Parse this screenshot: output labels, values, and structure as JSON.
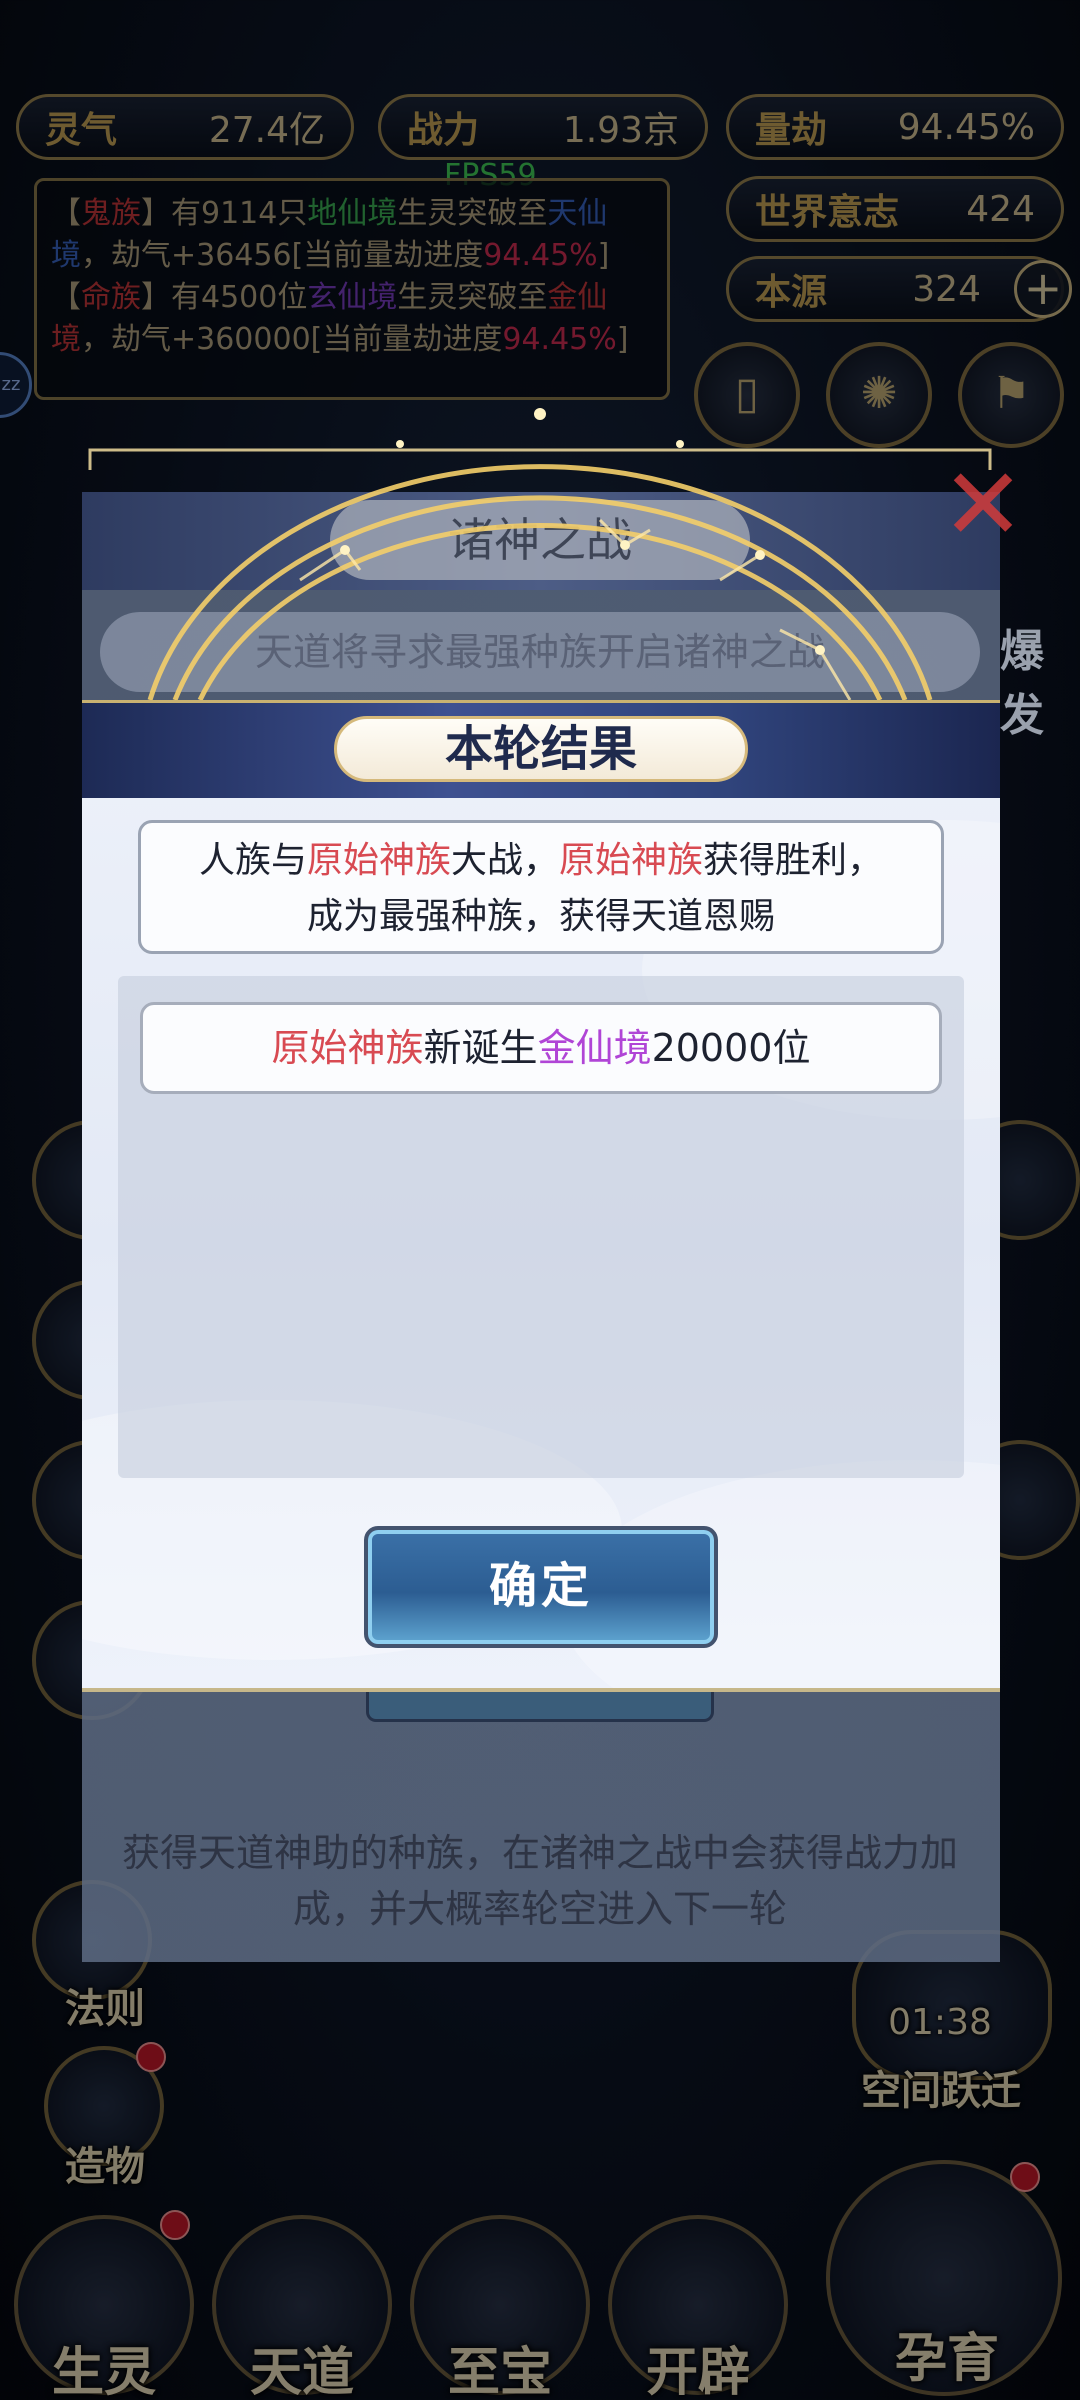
{
  "hud": {
    "qi": {
      "label": "灵气",
      "value": "27.4亿"
    },
    "power": {
      "label": "战力",
      "value": "1.93京"
    },
    "calamity": {
      "label": "量劫",
      "value": "94.45%"
    },
    "world_will": {
      "label": "世界意志",
      "value": "424"
    },
    "origin": {
      "label": "本源",
      "value": "324",
      "plus": "+"
    },
    "fps": "FPS59"
  },
  "log": {
    "line1": {
      "tag_open": "【",
      "race": "鬼族",
      "tag_close": "】",
      "t1": "有9114只",
      "realm": "地仙境",
      "t2": "生灵突破至",
      "target": "天仙境",
      "t3": "，劫气+36456[当前量劫进度",
      "progress": "94.45%",
      "t4": "]"
    },
    "line2": {
      "tag_open": "【",
      "race": "命族",
      "tag_close": "】",
      "t1": "有4500位",
      "realm": "玄仙境",
      "t2": "生灵突破至",
      "target": "金仙境",
      "t3": "，劫气+360000[当前量劫进度",
      "progress": "94.45%",
      "t4": "]"
    },
    "zz": "zz"
  },
  "side_menu": {
    "law": "法则",
    "create": "造物",
    "space_jump": "空间跃迁",
    "timer": "01:38"
  },
  "bottom_nav": [
    "生灵",
    "天道",
    "至宝",
    "开辟",
    "孕育"
  ],
  "background_dialog": {
    "title": "诸神之战",
    "subtitle": "天道将寻求最强种族开启诸神之战",
    "burst": "爆发",
    "description": "获得天道神助的种族，在诸神之战中会获得战力加成，并大概率轮空进入下一轮"
  },
  "modal": {
    "title": "本轮结果",
    "message": {
      "p1": "人族与",
      "race1": "原始神族",
      "p2": "大战，",
      "race2": "原始神族",
      "p3": "获得胜利，",
      "line2": "成为最强种族，获得天道恩赐"
    },
    "result": {
      "race": "原始神族",
      "p1": "新诞生",
      "realm": "金仙境",
      "p2": "20000位"
    },
    "confirm": "确定"
  },
  "colors": {
    "highlight_red": "#d84a52",
    "highlight_purple": "#b045d6",
    "hud_gold": "#c9a658",
    "modal_header_blue": "#30447c"
  }
}
